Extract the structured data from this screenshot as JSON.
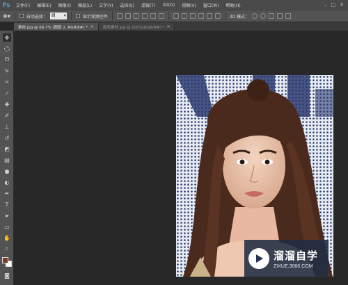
{
  "app": {
    "logo": "Ps"
  },
  "menu": [
    "文件(F)",
    "编辑(E)",
    "图像(I)",
    "图层(L)",
    "文字(Y)",
    "选择(S)",
    "滤镜(T)",
    "3D(D)",
    "视图(V)",
    "窗口(W)",
    "帮助(H)"
  ],
  "window_controls": [
    "–",
    "□",
    "✕"
  ],
  "options": {
    "auto_select_label": "自动选择：",
    "auto_select_value": "组",
    "show_transform_label": "显示变换控件",
    "mode_3d_label": "3D 模式："
  },
  "tabs": [
    {
      "label": "素材.jpg @ 66.7% (图层 2, RGB/8#) *",
      "close": "×",
      "active": true
    },
    {
      "label": "眉毛素材.jpg @ 100%(RGB/8#) *",
      "close": "×",
      "active": false
    }
  ],
  "tools": [
    "move-icon",
    "marquee-icon",
    "lasso-icon",
    "quick-select-icon",
    "crop-icon",
    "eyedropper-icon",
    "spot-heal-icon",
    "brush-icon",
    "clone-stamp-icon",
    "history-brush-icon",
    "eraser-icon",
    "gradient-icon",
    "blur-icon",
    "dodge-icon",
    "pen-icon",
    "type-icon",
    "path-select-icon",
    "rectangle-icon",
    "hand-icon",
    "zoom-icon"
  ],
  "colors": {
    "foreground": "#7a3b22",
    "background": "#ffffff",
    "accent": "#4fa8e8"
  },
  "watermark": {
    "title": "溜溜自学",
    "url": "ZIXUE.3066.COM"
  }
}
